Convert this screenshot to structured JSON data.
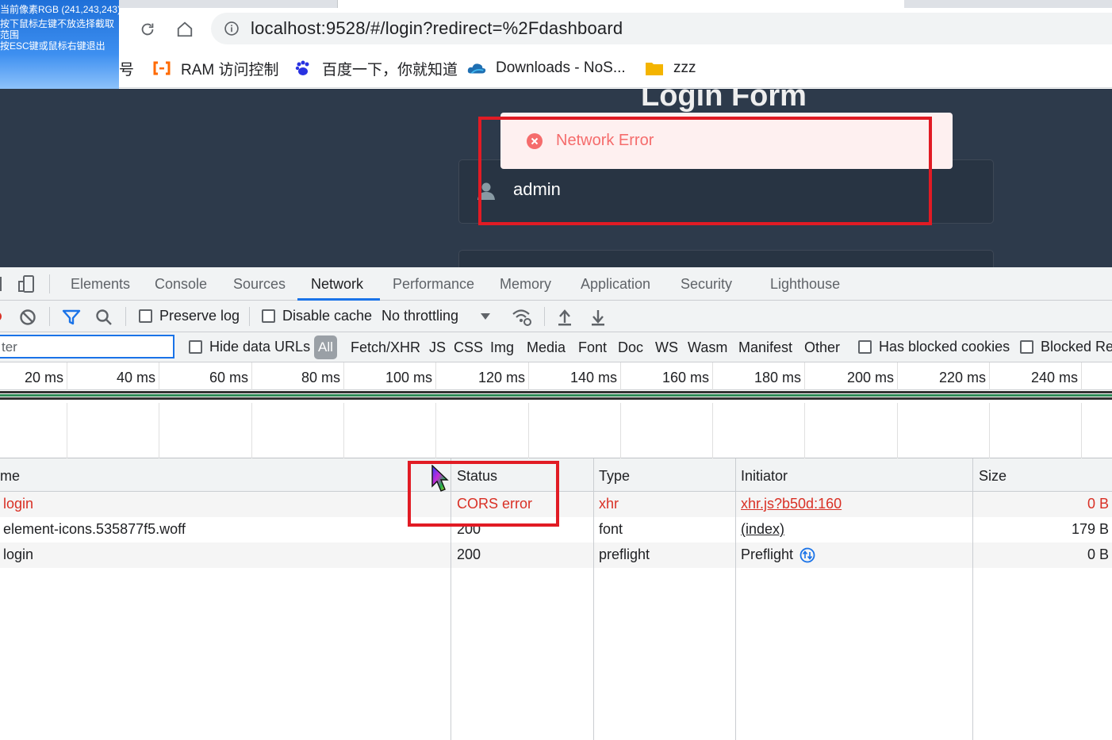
{
  "browser": {
    "url": "localhost:9528/#/login?redirect=%2Fdashboard",
    "bookmarks": [
      {
        "label": "号",
        "icon": "bookmark-icon"
      },
      {
        "label": "RAM 访问控制",
        "icon": "aliyun-icon"
      },
      {
        "label": "百度一下，你就知道",
        "icon": "baidu-paw-icon"
      },
      {
        "label": "Downloads - NoS...",
        "icon": "cloud-icon"
      },
      {
        "label": "zzz",
        "icon": "folder-icon"
      }
    ]
  },
  "capture_tool": {
    "line1": "当前像素RGB (241,243,243)",
    "line2": "按下鼠标左键不放选择截取",
    "line2b": "范围",
    "line3": "按ESC键或鼠标右键退出"
  },
  "page": {
    "title": "Login Form",
    "username": "admin",
    "message": "Network Error"
  },
  "devtools": {
    "tabs": [
      "Elements",
      "Console",
      "Sources",
      "Network",
      "Performance",
      "Memory",
      "Application",
      "Security",
      "Lighthouse"
    ],
    "active_tab": "Network",
    "toolbar": {
      "preserve_log": "Preserve log",
      "disable_cache": "Disable cache",
      "throttling": "No throttling"
    },
    "filter": {
      "placeholder": "ter",
      "hide_data_urls": "Hide data URLs",
      "types": [
        "All",
        "Fetch/XHR",
        "JS",
        "CSS",
        "Img",
        "Media",
        "Font",
        "Doc",
        "WS",
        "Wasm",
        "Manifest",
        "Other"
      ],
      "has_blocked_cookies": "Has blocked cookies",
      "blocked_requests": "Blocked Rec"
    },
    "timeline_ticks": [
      "20 ms",
      "40 ms",
      "60 ms",
      "80 ms",
      "100 ms",
      "120 ms",
      "140 ms",
      "160 ms",
      "180 ms",
      "200 ms",
      "220 ms",
      "240 ms"
    ],
    "table": {
      "columns": [
        "me",
        "Status",
        "Type",
        "Initiator",
        "Size"
      ],
      "rows": [
        {
          "name": "login",
          "status": "CORS error",
          "type": "xhr",
          "initiator": "xhr.js?b50d:160",
          "size": "0 B"
        },
        {
          "name": "element-icons.535877f5.woff",
          "status": "200",
          "type": "font",
          "initiator": "(index)",
          "size": "179 B"
        },
        {
          "name": "login",
          "status": "200",
          "type": "preflight",
          "initiator": "Preflight",
          "size": "0 B"
        }
      ]
    }
  },
  "colors": {
    "error_red": "#d93025",
    "message_red": "#f56c6c",
    "highlight_box": "#e11b24",
    "page_bg": "#2d3a4b",
    "accent_blue": "#1a73e8"
  }
}
